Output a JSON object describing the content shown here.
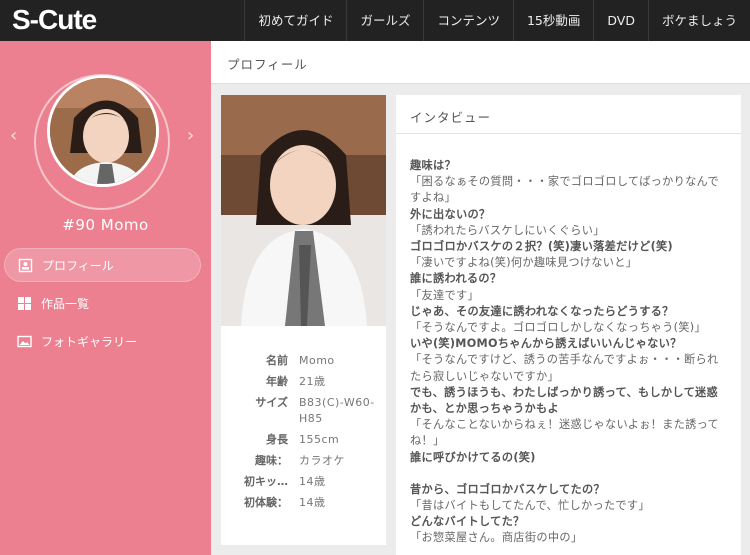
{
  "brand": {
    "logo": "S-Cute"
  },
  "nav": [
    "初めてガイド",
    "ガールズ",
    "コンテンツ",
    "15秒動画",
    "DVD",
    "ボケましょう"
  ],
  "sidebar": {
    "model_name": "#90 Momo",
    "menu": [
      {
        "label": "プロフィール",
        "icon": "profile-icon",
        "active": true
      },
      {
        "label": "作品一覧",
        "icon": "grid-icon",
        "active": false
      },
      {
        "label": "フォトギャラリー",
        "icon": "photo-icon",
        "active": false
      }
    ]
  },
  "page": {
    "title": "プロフィール"
  },
  "profile": [
    {
      "key": "名前",
      "value": "Momo"
    },
    {
      "key": "年齢",
      "value": "21歳"
    },
    {
      "key": "サイズ",
      "value": "B83(C)-W60-H85"
    },
    {
      "key": "身長",
      "value": "155cm"
    },
    {
      "key": "趣味：",
      "value": "カラオケ"
    },
    {
      "key": "初キッ…",
      "value": "14歳"
    },
    {
      "key": "初体験：",
      "value": "14歳"
    }
  ],
  "interview": {
    "title": "インタビュー",
    "lines": [
      {
        "type": "q",
        "text": "趣味は？"
      },
      {
        "type": "a",
        "text": "「困るなぁその質問・・・家でゴロゴロしてばっかりなんですよね」"
      },
      {
        "type": "q",
        "text": "外に出ないの？"
      },
      {
        "type": "a",
        "text": "「誘われたらバスケしにいくぐらい」"
      },
      {
        "type": "q",
        "text": "ゴロゴロかバスケの２択？(笑)凄い落差だけど(笑)"
      },
      {
        "type": "a",
        "text": "「凄いですよね(笑)何か趣味見つけないと」"
      },
      {
        "type": "q",
        "text": "誰に誘われるの？"
      },
      {
        "type": "a",
        "text": "「友達です」"
      },
      {
        "type": "q",
        "text": "じゃあ、その友達に誘われなくなったらどうする？"
      },
      {
        "type": "a",
        "text": "「そうなんですよ。ゴロゴロしかしなくなっちゃう(笑)」"
      },
      {
        "type": "q",
        "text": "いや(笑)MOMOちゃんから誘えばいいんじゃない？"
      },
      {
        "type": "a",
        "text": "「そうなんですけど、誘うの苦手なんですよぉ・・・断られたら寂しいじゃないですか」"
      },
      {
        "type": "q",
        "text": "でも、誘うほうも、わたしばっかり誘って、もしかして迷惑かも、とか思っちゃうかもよ"
      },
      {
        "type": "a",
        "text": "「そんなことないからねぇ！迷惑じゃないよぉ！また誘ってね！」"
      },
      {
        "type": "q",
        "text": "誰に呼びかけてるの(笑)"
      },
      {
        "type": "gap",
        "text": ""
      },
      {
        "type": "q",
        "text": "昔から、ゴロゴロかバスケしてたの？"
      },
      {
        "type": "a",
        "text": "「昔はバイトもしてたんで、忙しかったです」"
      },
      {
        "type": "q",
        "text": "どんなバイトしてた？"
      },
      {
        "type": "a",
        "text": "「お惣菜屋さん。商店街の中の」"
      }
    ]
  }
}
